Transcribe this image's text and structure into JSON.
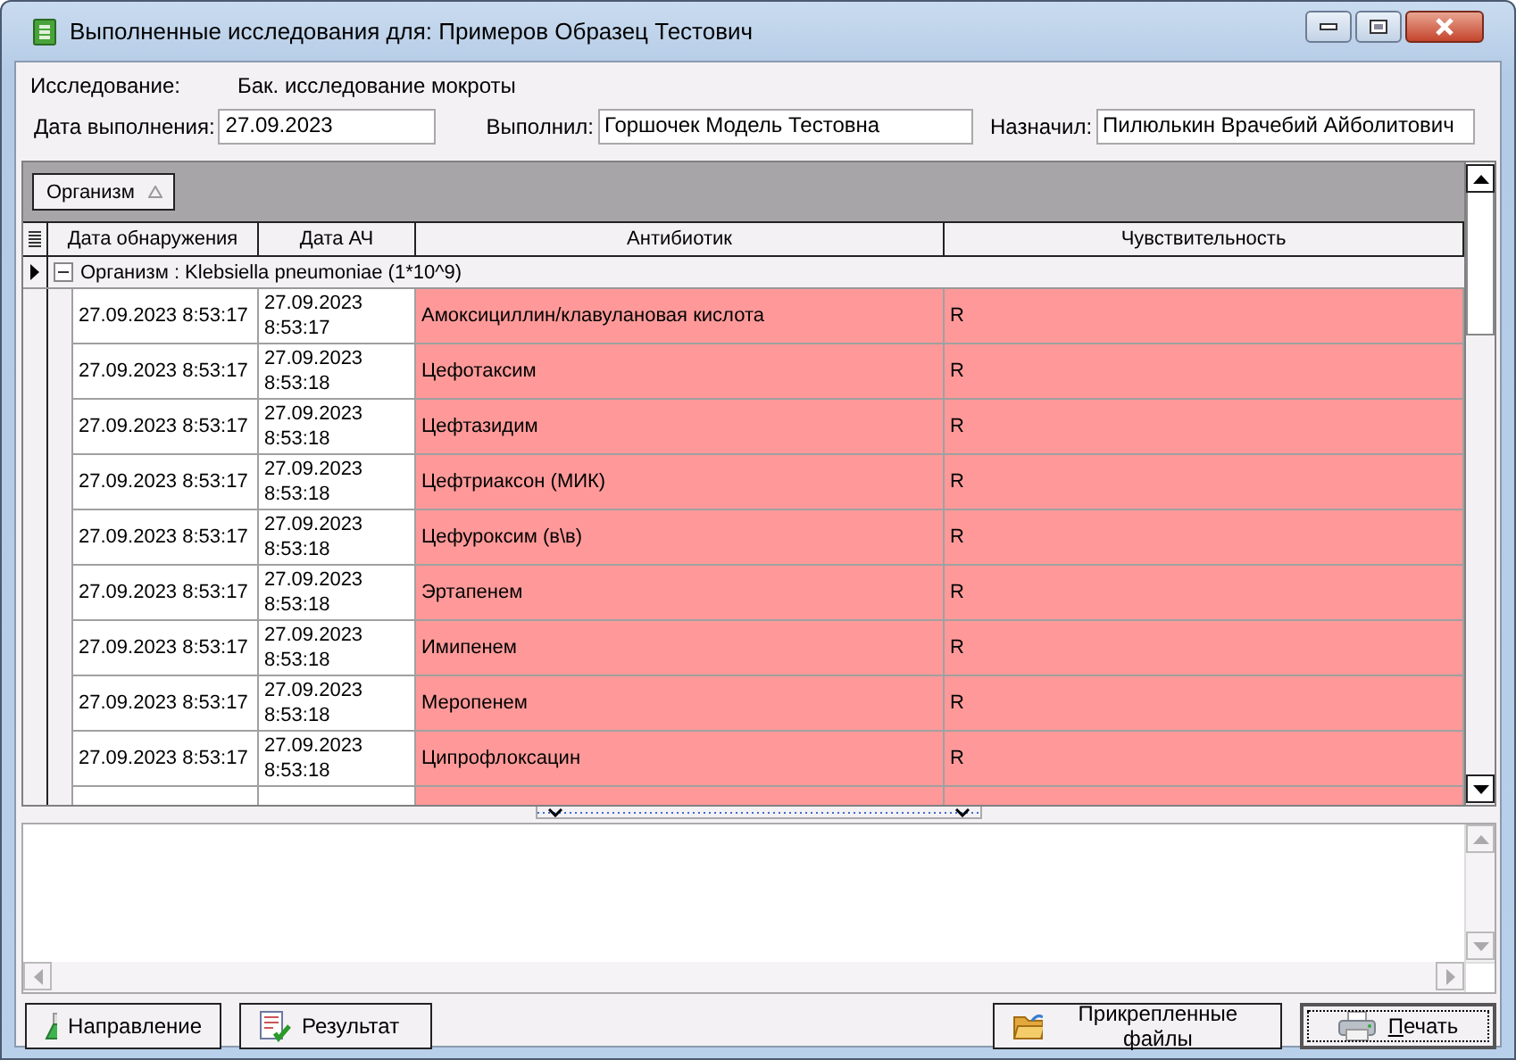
{
  "window": {
    "title": "Выполненные исследования для: Примеров Образец Тестович"
  },
  "study": {
    "label": "Исследование:",
    "value": "Бак. исследование мокроты"
  },
  "fields": [
    {
      "label": "Дата выполнения:",
      "value": "27.09.2023"
    },
    {
      "label": "Выполнил:",
      "value": "Горшочек Модель Тестовна"
    },
    {
      "label": "Назначил:",
      "value": "Пилюлькин Врачебий Айболитович"
    }
  ],
  "group_panel": {
    "chip": "Организм"
  },
  "grid": {
    "columns": [
      "Дата обнаружения",
      "Дата АЧ",
      "Антибиотик",
      "Чувствительность"
    ],
    "group": {
      "label": "Организм : Klebsiella pneumoniae (1*10^9)",
      "expanded": true,
      "selected": true
    },
    "rows": [
      {
        "detected": "27.09.2023 8:53:17",
        "ach": "27.09.2023 8:53:17",
        "antibiotic": "Амоксициллин/клавулановая кислота",
        "sensitivity": "R",
        "color": "#ff9999"
      },
      {
        "detected": "27.09.2023 8:53:17",
        "ach": "27.09.2023 8:53:18",
        "antibiotic": "Цефотаксим",
        "sensitivity": "R",
        "color": "#ff9999"
      },
      {
        "detected": "27.09.2023 8:53:17",
        "ach": "27.09.2023 8:53:18",
        "antibiotic": "Цефтазидим",
        "sensitivity": "R",
        "color": "#ff9999"
      },
      {
        "detected": "27.09.2023 8:53:17",
        "ach": "27.09.2023 8:53:18",
        "antibiotic": "Цефтриаксон (МИК)",
        "sensitivity": "R",
        "color": "#ff9999"
      },
      {
        "detected": "27.09.2023 8:53:17",
        "ach": "27.09.2023 8:53:18",
        "antibiotic": "Цефуроксим (в\\в)",
        "sensitivity": "R",
        "color": "#ff9999"
      },
      {
        "detected": "27.09.2023 8:53:17",
        "ach": "27.09.2023 8:53:18",
        "antibiotic": "Эртапенем",
        "sensitivity": "R",
        "color": "#ff9999"
      },
      {
        "detected": "27.09.2023 8:53:17",
        "ach": "27.09.2023 8:53:18",
        "antibiotic": "Имипенем",
        "sensitivity": "R",
        "color": "#ff9999"
      },
      {
        "detected": "27.09.2023 8:53:17",
        "ach": "27.09.2023 8:53:18",
        "antibiotic": "Меропенем",
        "sensitivity": "R",
        "color": "#ff9999"
      },
      {
        "detected": "27.09.2023 8:53:17",
        "ach": "27.09.2023 8:53:18",
        "antibiotic": "Ципрофлоксацин",
        "sensitivity": "R",
        "color": "#ff9999"
      },
      {
        "color": "#ff9999"
      }
    ]
  },
  "buttons": [
    {
      "kind": "flask",
      "label": "Направление"
    },
    {
      "kind": "report",
      "label": "Результат"
    },
    {
      "kind": "folder",
      "label": "Прикрепленные файлы"
    },
    {
      "kind": "printer",
      "label": "Печать",
      "default": true
    }
  ]
}
